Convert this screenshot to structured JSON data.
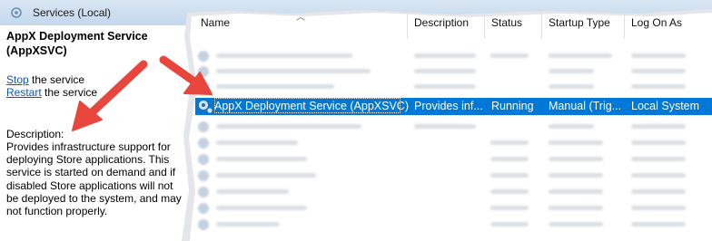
{
  "window": {
    "title": "Services (Local)"
  },
  "left_panel": {
    "service_name": "AppX Deployment Service (AppXSVC)",
    "stop_link": "Stop",
    "stop_rest": " the service",
    "restart_link": "Restart",
    "restart_rest": " the service",
    "description_label": "Description:",
    "description_text": "Provides infrastructure support for deploying Store applications. This service is started on demand and if disabled Store applications will not be deployed to the system, and may not function properly."
  },
  "columns": [
    "Name",
    "Description",
    "Status",
    "Startup Type",
    "Log On As"
  ],
  "selected_row": {
    "name": "AppX Deployment Service (AppXSVC)",
    "description": "Provides inf...",
    "status": "Running",
    "startup_type": "Manual (Trig...",
    "log_on_as": "Local System"
  },
  "colors": {
    "selection": "#0078d7",
    "arrow": "#e8463c",
    "link": "#0b56c2"
  },
  "icons": [
    "services-icon",
    "gear-icon"
  ]
}
